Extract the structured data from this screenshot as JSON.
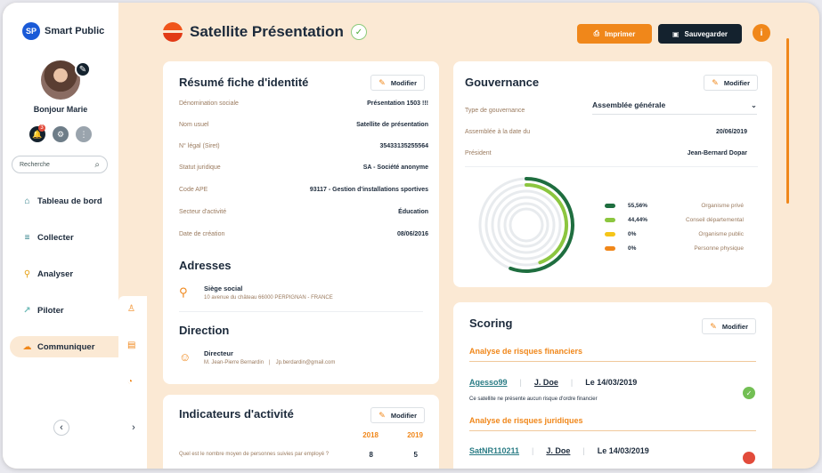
{
  "app": {
    "logo_badge": "SP",
    "name": "Smart Public"
  },
  "user": {
    "greeting": "Bonjour Marie",
    "notification_count": "3"
  },
  "search": {
    "placeholder": "Recherche"
  },
  "nav": [
    {
      "label": "Tableau de bord",
      "icon": "home-icon"
    },
    {
      "label": "Collecter",
      "icon": "database-icon"
    },
    {
      "label": "Analyser",
      "icon": "magnifier-icon"
    },
    {
      "label": "Piloter",
      "icon": "chart-line-icon"
    },
    {
      "label": "Communiquer",
      "icon": "chat-icon"
    }
  ],
  "header": {
    "title": "Satellite Présentation",
    "print_label": "Imprimer",
    "save_label": "Sauvegarder"
  },
  "identity": {
    "title": "Résumé fiche d'identité",
    "modify_label": "Modifier",
    "rows": [
      {
        "key": "Dénomination sociale",
        "value": "Présentation 1503 !!!"
      },
      {
        "key": "Nom usuel",
        "value": "Satellite de présentation"
      },
      {
        "key": "N° légal (Siret)",
        "value": "35433135255564"
      },
      {
        "key": "Statut juridique",
        "value": "SA - Société anonyme"
      },
      {
        "key": "Code APE",
        "value": "93117 - Gestion d'installations sportives"
      },
      {
        "key": "Secteur d'activité",
        "value": "Éducation"
      },
      {
        "key": "Date de création",
        "value": "08/06/2016"
      }
    ],
    "addresses_title": "Adresses",
    "address_label": "Siège social",
    "address_value": "10 avenue du château 66000 PERPIGNAN - FRANCE",
    "direction_title": "Direction",
    "director_label": "Directeur",
    "director_name": "M. Jean-Pierre Bernardin",
    "director_email": "Jp.berdardin@gmail.com"
  },
  "activity": {
    "title": "Indicateurs d'activité",
    "modify_label": "Modifier",
    "years": [
      "2018",
      "2019"
    ],
    "question": "Quel est le nombre moyen de personnes suivies par employé ?",
    "values": [
      "8",
      "5"
    ]
  },
  "governance": {
    "title": "Gouvernance",
    "modify_label": "Modifier",
    "type_key": "Type de gouvernance",
    "type_value": "Assemblée générale",
    "date_key": "Assemblée à la date du",
    "date_value": "20/06/2019",
    "president_key": "Président",
    "president_value": "Jean-Bernard Dopar",
    "colors": {
      "prive": "#1f6e3f",
      "departemental": "#8cc63f",
      "public": "#f5c518",
      "physique": "#f0871a"
    }
  },
  "chart_data": {
    "type": "pie",
    "categories": [
      "Organisme privé",
      "Conseil départemental",
      "Organisme public",
      "Personne physique"
    ],
    "values": [
      55.56,
      44.44,
      0,
      0
    ],
    "labels": [
      "55,56%",
      "44,44%",
      "0%",
      "0%"
    ]
  },
  "scoring": {
    "title": "Scoring",
    "modify_label": "Modifier",
    "financial_title": "Analyse de risques financiers",
    "financial": {
      "code": "Agesso99",
      "user": "J. Doe",
      "date": "Le 14/03/2019",
      "note": "Ce satellite ne présente aucun risque d'ordre financier"
    },
    "legal_title": "Analyse de risques juridiques",
    "legal": {
      "code": "SatNR110211",
      "user": "J. Doe",
      "date": "Le 14/03/2019"
    }
  }
}
